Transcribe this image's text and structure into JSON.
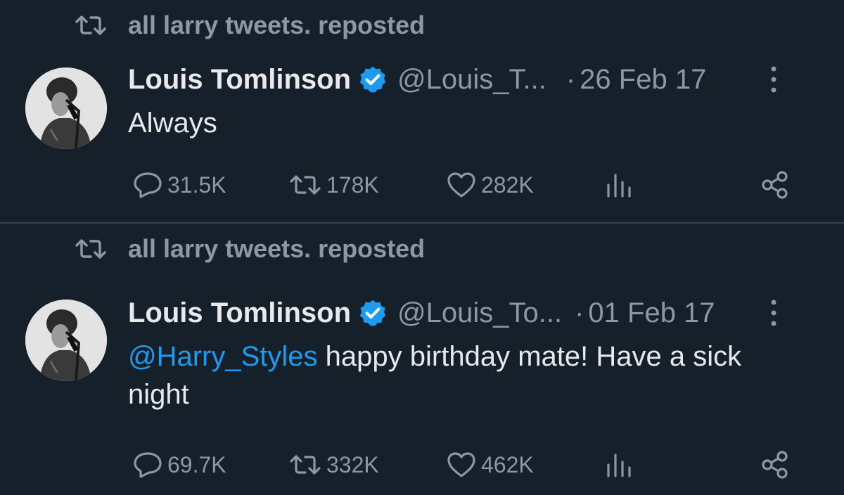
{
  "tweets": [
    {
      "repost_label": "all larry tweets. reposted",
      "author_name": "Louis Tomlinson",
      "handle": "@Louis_T...",
      "date_dot": "·",
      "date": "26 Feb 17",
      "text_mention": "",
      "text": "Always",
      "replies": "31.5K",
      "reposts": "178K",
      "likes": "282K"
    },
    {
      "repost_label": "all larry tweets. reposted",
      "author_name": "Louis Tomlinson",
      "handle": "@Louis_To...",
      "date_dot": "·",
      "date": "01 Feb 17",
      "text_mention": "@Harry_Styles",
      "text": " happy birthday mate! Have a sick night",
      "replies": "69.7K",
      "reposts": "332K",
      "likes": "462K"
    }
  ],
  "icons": {
    "repost": "repost-icon",
    "verified": "verified-badge-icon",
    "more": "more-options-icon",
    "reply": "reply-icon",
    "like": "heart-icon",
    "views": "views-chart-icon",
    "share": "share-icon"
  },
  "colors": {
    "background": "#15202b",
    "text": "#e7e9ea",
    "muted": "#8b98a5",
    "link": "#1d9bf0",
    "verified": "#1d9bf0",
    "divider": "#38444d"
  }
}
